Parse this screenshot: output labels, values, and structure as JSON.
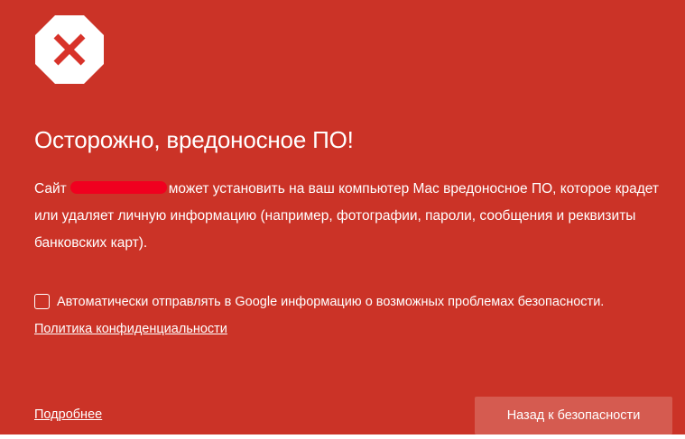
{
  "interstitial": {
    "icon": "warning-octagon-x-icon",
    "title": "Осторожно, вредоносное ПО!",
    "body_prefix": "Сайт",
    "body_suffix": "может установить на ваш компьютер Mac вредоносное ПО, которое крадет или удаляет личную информацию (например, фотографии, пароли, сообщения и реквизиты банковских карт).",
    "report_checkbox_label": "Автоматически отправлять в Google информацию о возможных проблемах безопасности.",
    "report_checkbox_checked": false,
    "privacy_link": "Политика конфиденциальности",
    "details_link": "Подробнее",
    "back_button": "Назад к безопасности"
  },
  "colors": {
    "background": "#cb3327",
    "text": "#ffffff",
    "redaction": "#f0001f",
    "icon_x": "#d8332a",
    "button": "#d55b50"
  }
}
